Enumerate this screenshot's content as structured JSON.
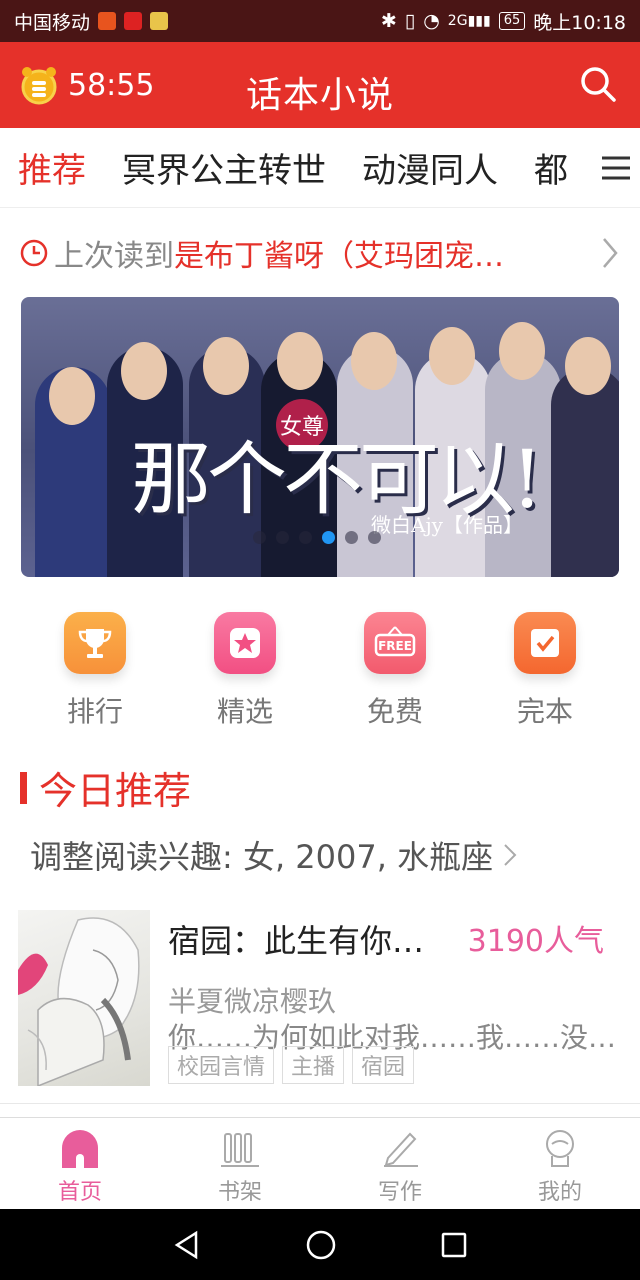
{
  "status_bar": {
    "carrier": "中国移动",
    "network": "2G",
    "battery": "65",
    "time": "晚上10:18"
  },
  "header": {
    "timer": "58:55",
    "title": "话本小说"
  },
  "tabs": [
    {
      "label": "推荐",
      "active": true
    },
    {
      "label": "冥界公主转世",
      "active": false
    },
    {
      "label": "动漫同人",
      "active": false
    },
    {
      "label": "都",
      "active": false
    }
  ],
  "last_read": {
    "label": "上次读到",
    "book": "是布丁酱呀（艾玛团宠…"
  },
  "banner": {
    "title": "那个不可以!",
    "tag": "女尊",
    "author": "微白Ajy【作品】",
    "dots_count": 6,
    "active_dot": 3
  },
  "quick_links": [
    {
      "label": "排行",
      "icon": "trophy-icon",
      "color": "#f7913a"
    },
    {
      "label": "精选",
      "icon": "star-icon",
      "color": "#f24f83"
    },
    {
      "label": "免费",
      "icon": "free-icon",
      "color": "#f25a6d"
    },
    {
      "label": "完本",
      "icon": "check-icon",
      "color": "#f4672f"
    }
  ],
  "today_section": {
    "title": "今日推荐",
    "interest": "调整阅读兴趣: 女, 2007, 水瓶座"
  },
  "book": {
    "title": "宿园：此生有你…",
    "popularity": "3190人气",
    "author": "半夏微凉樱玖",
    "desc": "你……为何如此对我……我……没…",
    "tags": [
      "校园言情",
      "主播",
      "宿园"
    ]
  },
  "bottom_nav": [
    {
      "label": "首页",
      "icon": "home-icon",
      "active": true
    },
    {
      "label": "书架",
      "icon": "bookshelf-icon",
      "active": false
    },
    {
      "label": "写作",
      "icon": "pen-icon",
      "active": false
    },
    {
      "label": "我的",
      "icon": "profile-icon",
      "active": false
    }
  ],
  "colors": {
    "brand_red": "#e5312a",
    "pink": "#e85d9b"
  }
}
